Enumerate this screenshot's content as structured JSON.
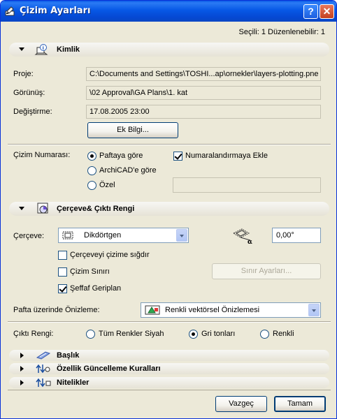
{
  "window": {
    "title": "Çizim Ayarları",
    "help_glyph": "?",
    "close_glyph": "✕",
    "icon": "drawing-settings-icon"
  },
  "selection_info": "Seçili: 1 Düzenlenebilir: 1",
  "identity": {
    "header": "Kimlik",
    "icon": "identity-info-icon",
    "project_label": "Proje:",
    "project_value": "C:\\Documents and Settings\\TOSHI...ap\\ornekler\\layers-plotting.pne",
    "view_label": "Görünüş:",
    "view_value": "\\02 Approval\\GA Plans\\1. kat",
    "modified_label": "Değiştirme:",
    "modified_value": "17.08.2005 23:00",
    "extra_info_button": "Ek Bilgi...",
    "numbering_label": "Çizim Numarası:",
    "numbering_options": [
      "Paftaya göre",
      "ArchiCAD'e göre",
      "Özel"
    ],
    "numbering_selected": "Paftaya göre",
    "add_to_numbering_label": "Numaralandırmaya Ekle",
    "add_to_numbering_checked": true,
    "custom_number_value": ""
  },
  "frame": {
    "header": "Çerçeve& Çıktı Rengi",
    "icon": "frame-color-icon",
    "frame_label": "Çerçeve:",
    "frame_select_value": "Dikdörtgen",
    "frame_select_icon": "rectangle-frame-icon",
    "angle_icon": "rotation-angle-icon",
    "angle_value": "0,00°",
    "fit_frame_label": "Çerçeveyi çizime sığdır",
    "fit_frame_checked": false,
    "draw_border_label": "Çizim Sınırı",
    "draw_border_checked": false,
    "border_settings_button": "Sınır Ayarları...",
    "transparent_bg_label": "Şeffaf Geriplan",
    "transparent_bg_checked": true,
    "preview_label": "Pafta üzerinde Önizleme:",
    "preview_select_value": "Renkli vektörsel Önizlemesi",
    "preview_select_icon": "color-vector-preview-icon",
    "output_color_label": "Çıktı Rengi:",
    "output_color_options": [
      "Tüm Renkler Siyah",
      "Gri tonları",
      "Renkli"
    ],
    "output_color_selected": "Gri tonları"
  },
  "collapsed_sections": [
    {
      "label": "Başlık",
      "icon": "title-tag-icon"
    },
    {
      "label": "Özellik Güncelleme Kuralları",
      "icon": "property-update-rules-icon"
    },
    {
      "label": "Nitelikler",
      "icon": "attributes-icon"
    }
  ],
  "footer": {
    "cancel_button": "Vazgeç",
    "ok_button": "Tamam"
  }
}
